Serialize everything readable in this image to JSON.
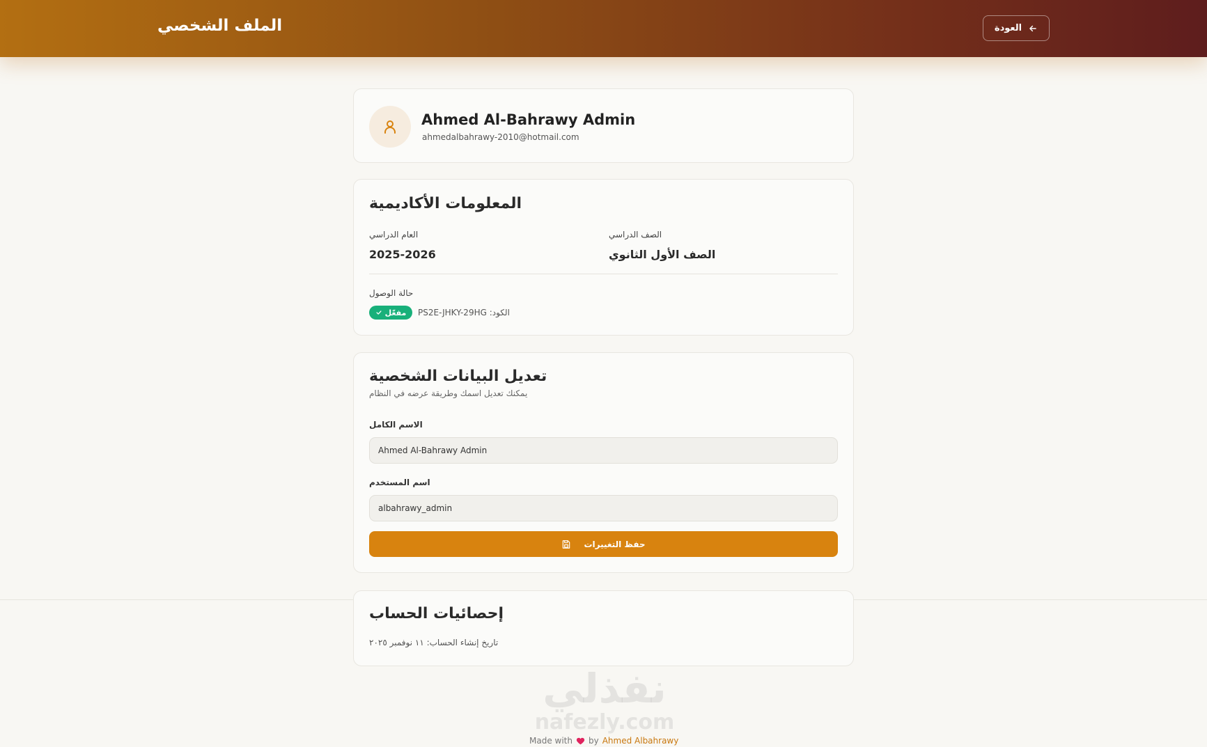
{
  "header": {
    "title": "الملف الشخصي",
    "back_label": "العودة"
  },
  "profile": {
    "name": "Ahmed Al-Bahrawy Admin",
    "email": "ahmedalbahrawy-2010@hotmail.com"
  },
  "academic": {
    "heading": "المعلومات الأكاديمية",
    "year_label": "العام الدراسي",
    "year_value": "2025-2026",
    "grade_label": "الصف الدراسي",
    "grade_value": "الصف الأول الثانوي",
    "access_label": "حالة الوصول",
    "status_badge": "مفعّل",
    "code_text": "الكود: PS2E-JHKY-29HG"
  },
  "edit": {
    "heading": "تعديل البيانات الشخصية",
    "subtitle": "يمكنك تعديل اسمك وطريقة عرضه في النظام",
    "fullname_label": "الاسم الكامل",
    "fullname_value": "Ahmed Al-Bahrawy Admin",
    "username_label": "اسم المستخدم",
    "username_value": "albahrawy_admin",
    "save_label": "حفظ التغييرات"
  },
  "stats": {
    "heading": "إحصائيات الحساب",
    "created_text": "تاريخ إنشاء الحساب: ١١ نوفمبر ٢٠٢٥"
  },
  "watermark": {
    "arabic": "نفذلي",
    "latin": "nafezly.com"
  },
  "footer": {
    "made_with": "Made with",
    "by": "by",
    "author": "Ahmed Albahrawy"
  },
  "colors": {
    "accent": "#d8830f",
    "success": "#18b07a",
    "header_start": "#b36f12",
    "header_end": "#5e1d1d"
  },
  "icons": {
    "back": "arrow-left-icon",
    "avatar": "user-icon",
    "status": "check-icon",
    "save": "save-icon",
    "heart": "heart-icon"
  }
}
